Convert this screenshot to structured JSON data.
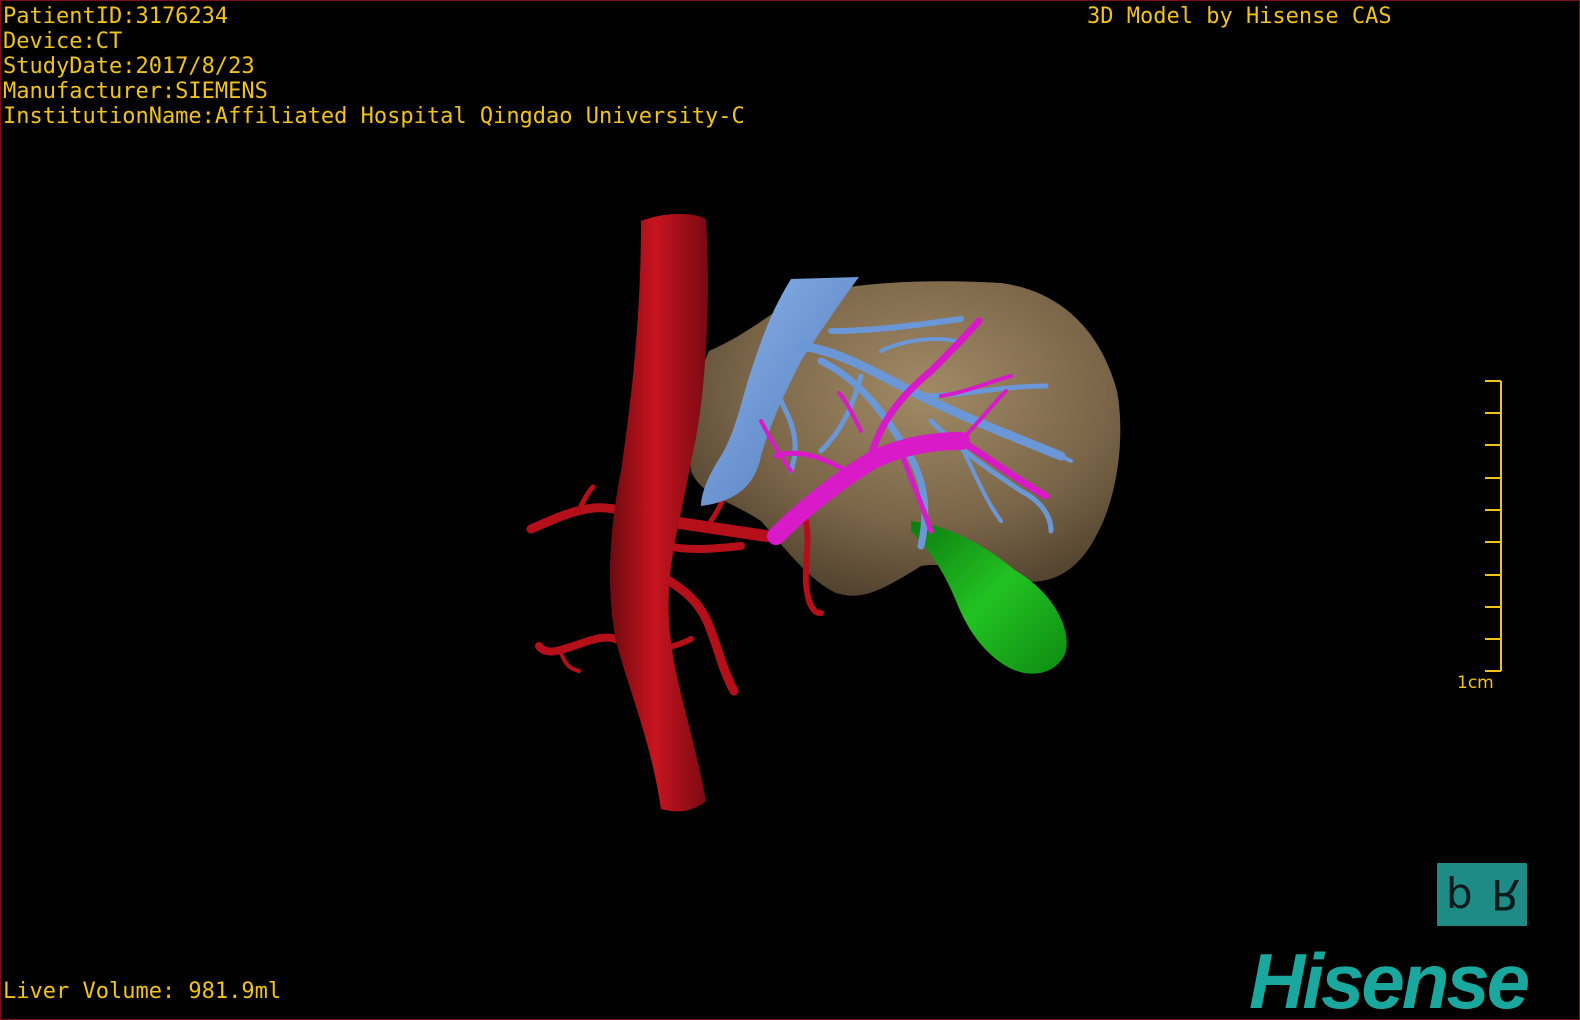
{
  "study_info": {
    "patient_id": "PatientID:3176234",
    "device": "Device:CT",
    "study_date": "StudyDate:2017/8/23",
    "manufacturer": "Manufacturer:SIEMENS",
    "institution": "InstitutionName:Affiliated Hospital Qingdao University-C"
  },
  "credit": "3D Model by Hisense CAS",
  "liver_volume": "Liver Volume: 981.9ml",
  "scale_bar": {
    "label": "1cm"
  },
  "orientation_cube": {
    "left_glyph": "d",
    "right_glyph": "R"
  },
  "brand": {
    "logo_text": "Hisense"
  },
  "colors": {
    "overlay_text": "#f2c21c",
    "viewport_border": "#7a0f1a",
    "artery": "#b5101a",
    "liver": "#7a6548",
    "hepatic_vein": "#6b97d6",
    "portal_vein": "#d81ac8",
    "gallbladder": "#18b418",
    "brand": "#1aa89e"
  }
}
